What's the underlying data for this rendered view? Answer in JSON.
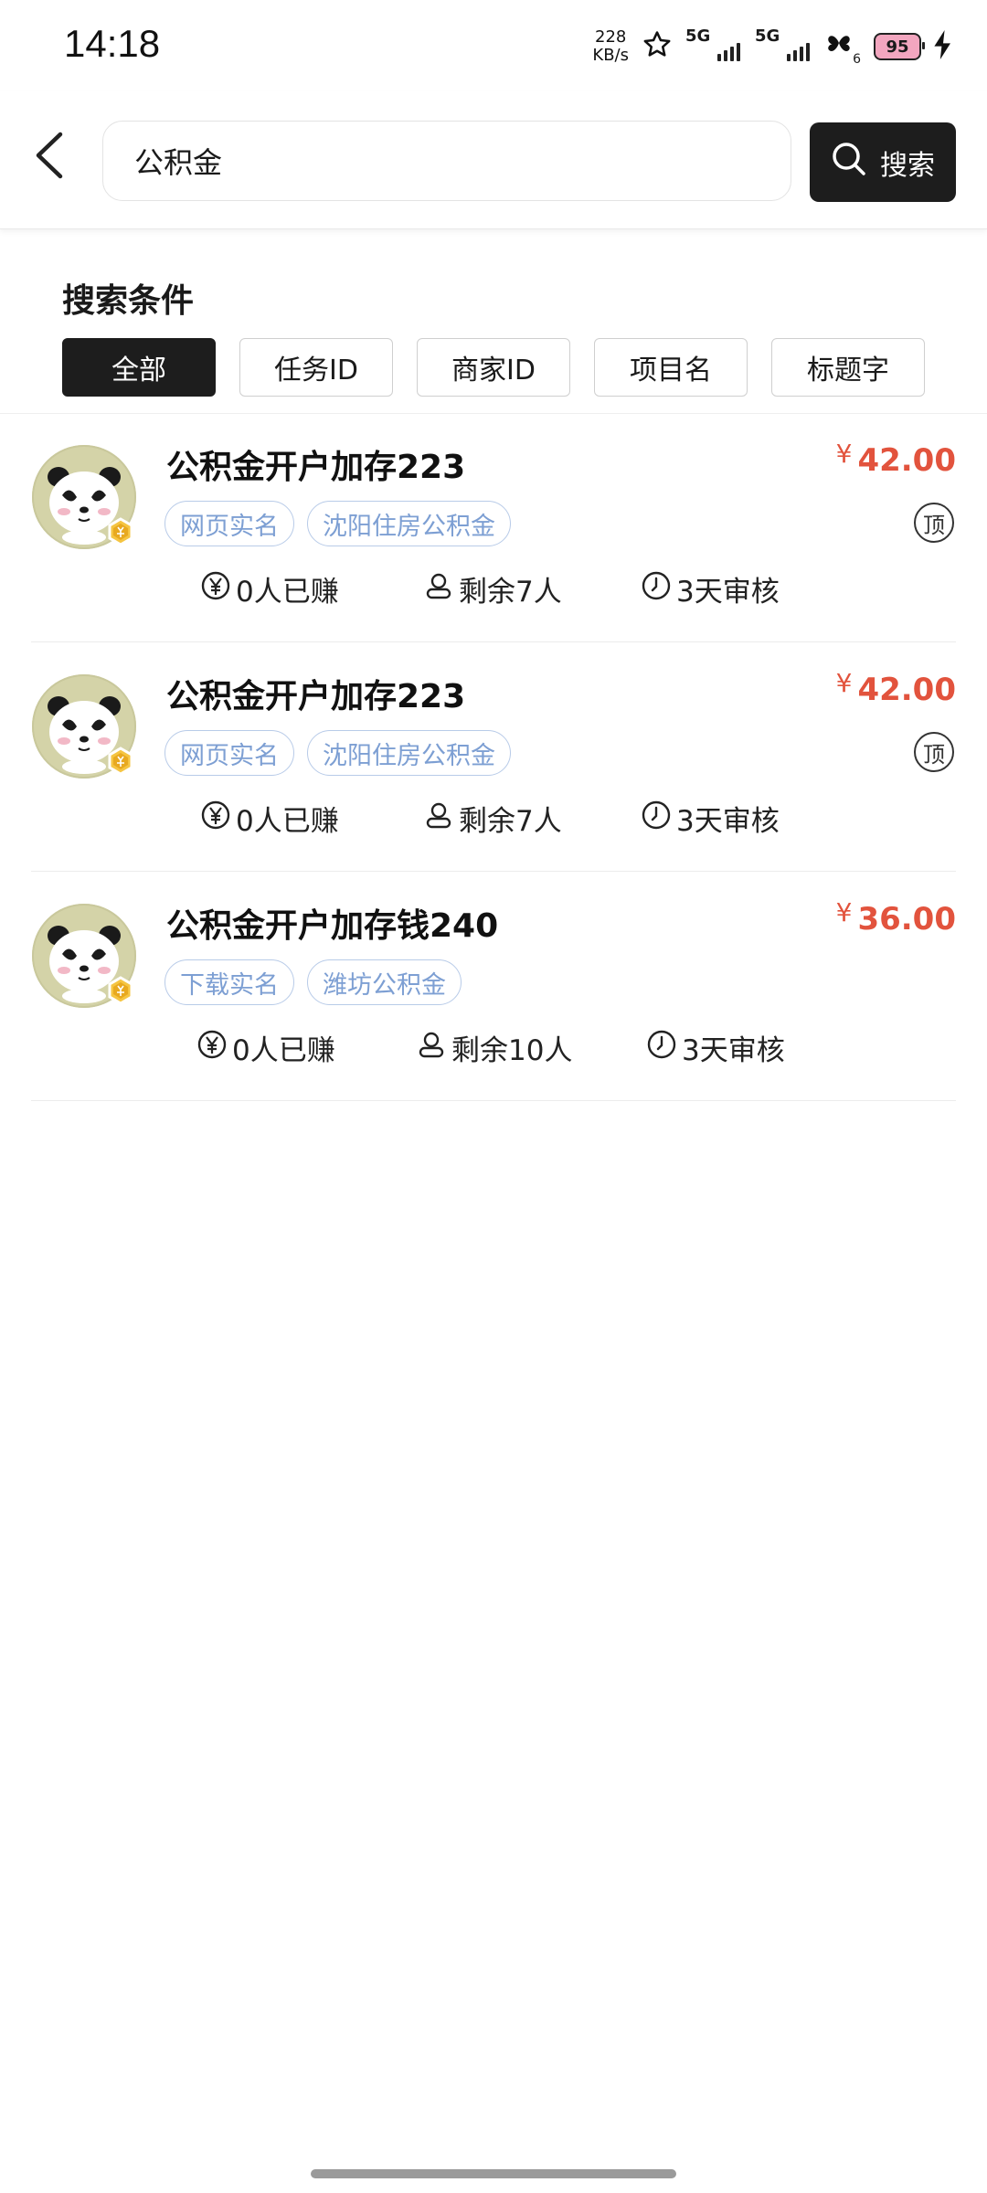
{
  "status_bar": {
    "time": "14:18",
    "speed_value": "228",
    "speed_unit": "KB/s",
    "sim1": "5G",
    "sim2": "5G",
    "bt_sub": "6",
    "battery": "95"
  },
  "header": {
    "search_value": "公积金",
    "search_button": "搜索"
  },
  "filters": {
    "title": "搜索条件",
    "chips": [
      "全部",
      "任务ID",
      "商家ID",
      "项目名",
      "标题字"
    ],
    "active_index": 0
  },
  "tasks": [
    {
      "title": "公积金开户加存223",
      "tags": [
        "网页实名",
        "沈阳住房公积金"
      ],
      "currency": "¥",
      "price": "42.00",
      "pinned": true,
      "pinned_label": "顶",
      "earned": "0人已赚",
      "remaining": "剩余7人",
      "review": "3天审核"
    },
    {
      "title": "公积金开户加存223",
      "tags": [
        "网页实名",
        "沈阳住房公积金"
      ],
      "currency": "¥",
      "price": "42.00",
      "pinned": true,
      "pinned_label": "顶",
      "earned": "0人已赚",
      "remaining": "剩余7人",
      "review": "3天审核"
    },
    {
      "title": "公积金开户加存钱240",
      "tags": [
        "下载实名",
        "潍坊公积金"
      ],
      "currency": "¥",
      "price": "36.00",
      "pinned": false,
      "earned": "0人已赚",
      "remaining": "剩余10人",
      "review": "3天审核"
    }
  ],
  "colors": {
    "price_red": "#e2533d",
    "tag_blue": "#7d9fd3",
    "dark_button": "#1d1d1d"
  },
  "icons": {
    "back": "back-arrow-icon",
    "search": "search-icon",
    "earned": "yen-circle-icon",
    "remaining": "person-icon",
    "review": "clock-icon",
    "avatar": "panda-avatar-icon"
  }
}
